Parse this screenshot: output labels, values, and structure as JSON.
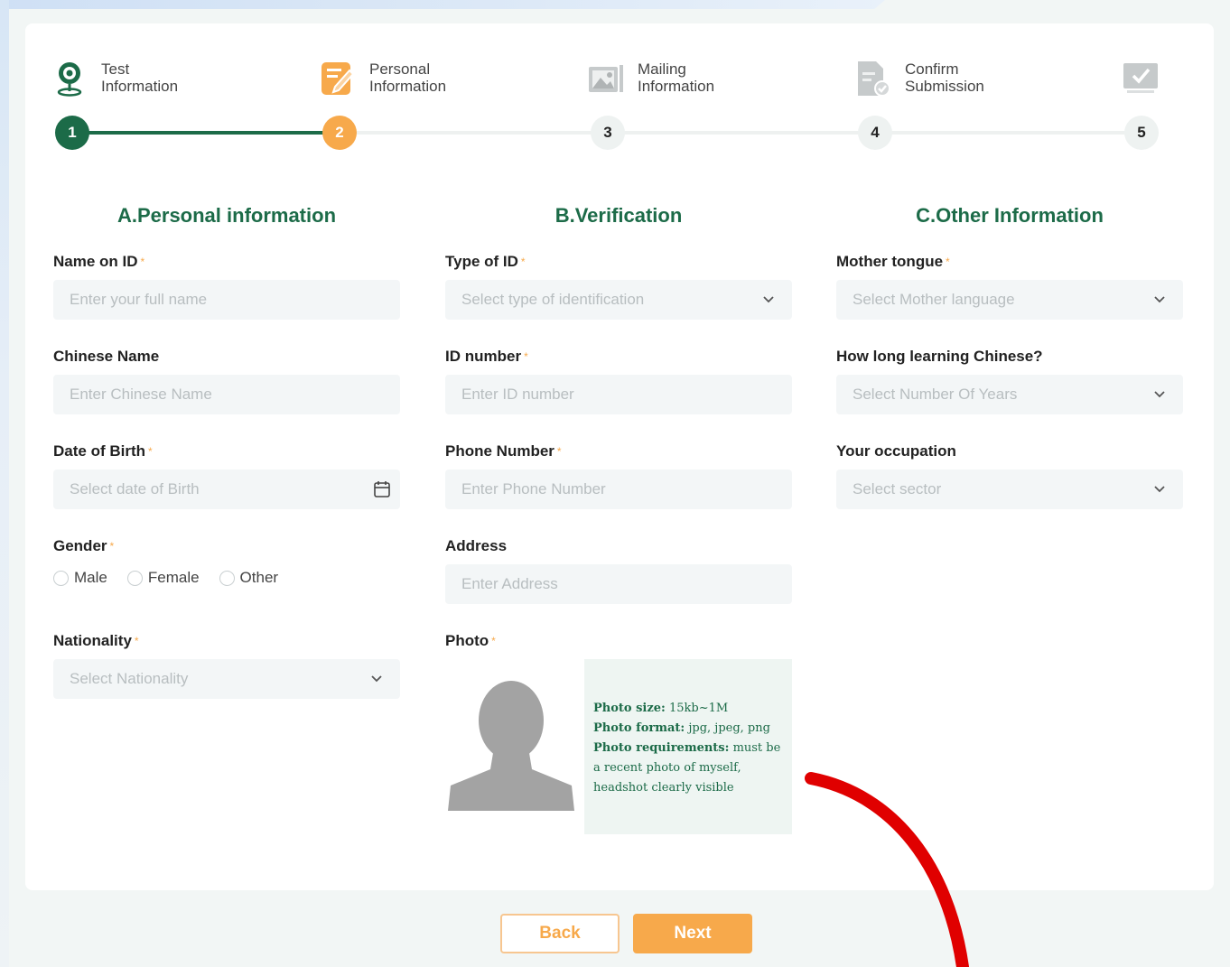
{
  "stepper": {
    "steps": [
      {
        "line1": "Test",
        "line2": "Information",
        "number": "1",
        "icon": "map-pin-icon",
        "state": "done"
      },
      {
        "line1": "Personal",
        "line2": "Information",
        "number": "2",
        "icon": "edit-form-icon",
        "state": "active"
      },
      {
        "line1": "Mailing",
        "line2": "Information",
        "number": "3",
        "icon": "image-icon",
        "state": "todo"
      },
      {
        "line1": "Confirm",
        "line2": "Submission",
        "number": "4",
        "icon": "document-check-icon",
        "state": "todo"
      },
      {
        "line1": "",
        "line2": "",
        "number": "5",
        "icon": "monitor-check-icon",
        "state": "todo"
      }
    ]
  },
  "personal": {
    "title": "A.Personal information",
    "name_label": "Name on ID",
    "name_placeholder": "Enter your full name",
    "chinese_label": "Chinese Name",
    "chinese_placeholder": "Enter Chinese Name",
    "dob_label": "Date of Birth",
    "dob_placeholder": "Select date of Birth",
    "gender_label": "Gender",
    "gender_options": [
      "Male",
      "Female",
      "Other"
    ],
    "nationality_label": "Nationality",
    "nationality_placeholder": "Select Nationality"
  },
  "verification": {
    "title": "B.Verification",
    "idtype_label": "Type of ID",
    "idtype_placeholder": "Select type of identification",
    "idnum_label": "ID number",
    "idnum_placeholder": "Enter ID number",
    "phone_label": "Phone Number",
    "phone_placeholder": "Enter Phone Number",
    "address_label": "Address",
    "address_placeholder": "Enter Address",
    "photo_label": "Photo",
    "photo_size_label": "Photo size:",
    "photo_size_value": "15kb~1M",
    "photo_format_label": "Photo format:",
    "photo_format_value": "jpg, jpeg, png",
    "photo_req_label": "Photo requirements:",
    "photo_req_value": "must be a recent photo of myself, headshot clearly visible"
  },
  "other": {
    "title": "C.Other Information",
    "tongue_label": "Mother tongue",
    "tongue_placeholder": "Select Mother language",
    "years_label": "How long learning Chinese?",
    "years_placeholder": "Select Number Of Years",
    "occupation_label": "Your occupation",
    "occupation_placeholder": "Select sector"
  },
  "required_mark": "*",
  "buttons": {
    "back": "Back",
    "next": "Next"
  },
  "colors": {
    "primary": "#1c6b48",
    "accent": "#f7a94b",
    "annotation": "#e00000"
  }
}
